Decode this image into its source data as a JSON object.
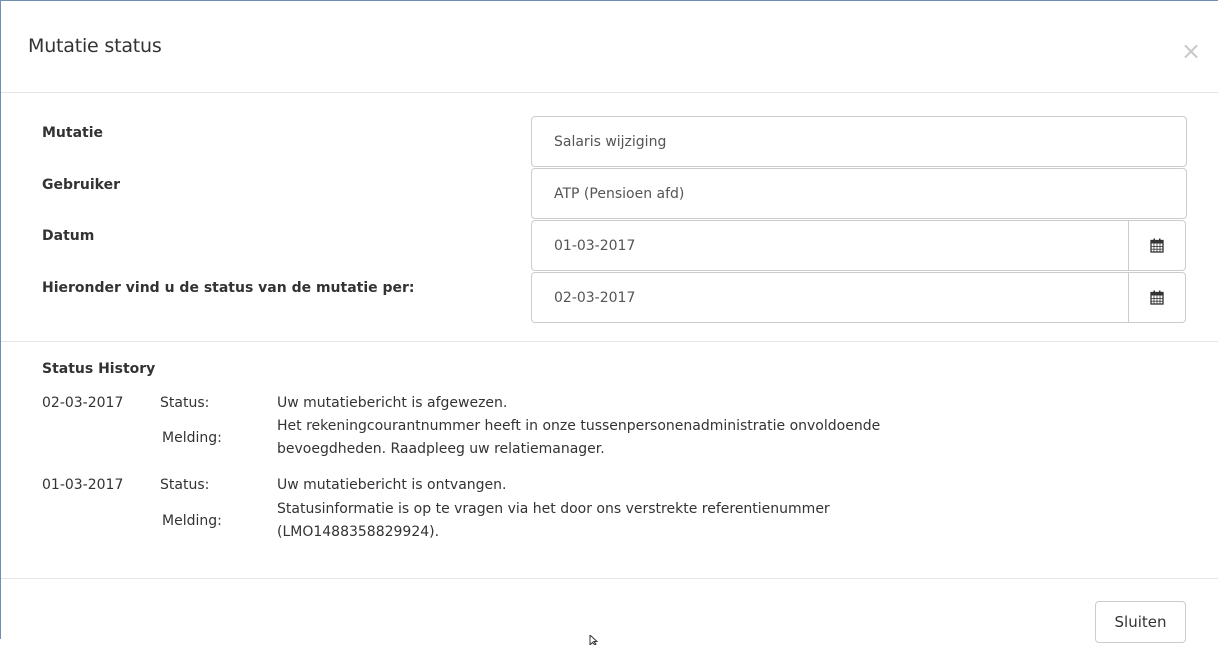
{
  "modal": {
    "title": "Mutatie status",
    "close_symbol": "×"
  },
  "form": {
    "mutatie_label": "Mutatie",
    "mutatie_value": "Salaris wijziging",
    "gebruiker_label": "Gebruiker",
    "gebruiker_value": "ATP (Pensioen afd)",
    "datum_label": "Datum",
    "datum_value": "01-03-2017",
    "per_label": "Hieronder vind u de status van de mutatie per:",
    "per_value": "02-03-2017"
  },
  "history": {
    "title": "Status History",
    "entries": [
      {
        "date": "02-03-2017",
        "status_label": "Status:",
        "status_text": "Uw mutatiebericht is afgewezen.",
        "melding_label": "Melding:",
        "melding_line1": "Het rekeningcourantnummer heeft in onze tussenpersonenadministratie onvoldoende",
        "melding_line2": "bevoegdheden. Raadpleeg uw relatiemanager."
      },
      {
        "date": "01-03-2017",
        "status_label": "Status:",
        "status_text": "Uw mutatiebericht is ontvangen.",
        "melding_label": "Melding:",
        "melding_line1": "Statusinformatie is op te vragen via het door ons verstrekte referentienummer",
        "melding_line2": "(LMO1488358829924)."
      }
    ]
  },
  "footer": {
    "close_label": "Sluiten"
  },
  "icons": {
    "calendar": "calendar-icon",
    "close": "close-icon",
    "cursor": "mouse-pointer-icon"
  }
}
